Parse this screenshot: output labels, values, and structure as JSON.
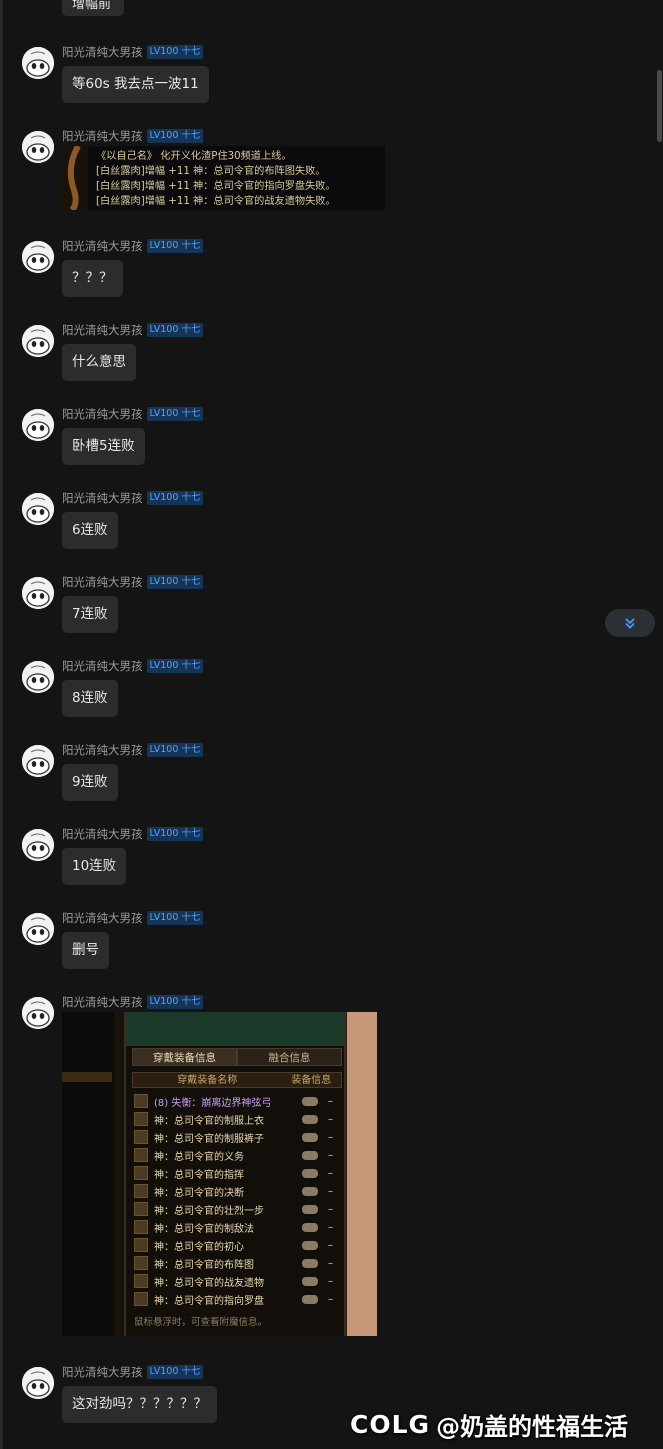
{
  "top_partial_text": "增幅前",
  "messages": [
    {
      "user": "阳光清纯大男孩",
      "level": "LV100 十七",
      "text": "等60s  我去点一波11"
    },
    {
      "user": "阳光清纯大男孩",
      "level": "LV100 十七",
      "image": "game-log"
    },
    {
      "user": "阳光清纯大男孩",
      "level": "LV100 十七",
      "text": "？？？"
    },
    {
      "user": "阳光清纯大男孩",
      "level": "LV100 十七",
      "text": "什么意思"
    },
    {
      "user": "阳光清纯大男孩",
      "level": "LV100 十七",
      "text": "卧槽5连败"
    },
    {
      "user": "阳光清纯大男孩",
      "level": "LV100 十七",
      "text": "6连败"
    },
    {
      "user": "阳光清纯大男孩",
      "level": "LV100 十七",
      "text": "7连败"
    },
    {
      "user": "阳光清纯大男孩",
      "level": "LV100 十七",
      "text": "8连败"
    },
    {
      "user": "阳光清纯大男孩",
      "level": "LV100 十七",
      "text": "9连败"
    },
    {
      "user": "阳光清纯大男孩",
      "level": "LV100 十七",
      "text": "10连败"
    },
    {
      "user": "阳光清纯大男孩",
      "level": "LV100 十七",
      "text": "删号"
    },
    {
      "user": "阳光清纯大男孩",
      "level": "LV100 十七",
      "image": "equipment-panel"
    },
    {
      "user": "阳光清纯大男孩",
      "level": "LV100 十七",
      "text": "这对劲吗？？？？？？"
    }
  ],
  "game_log": {
    "lines": [
      "《以自己名》 化开义化渣P住30频道上线。",
      "[白丝露肉]增幅 +11 神：总司令官的布阵图失败。",
      "[白丝露肉]增幅 +11 神：总司令官的指向罗盘失败。",
      "[白丝露肉]增幅 +11 神：总司令官的战友遗物失败。"
    ]
  },
  "equipment_panel": {
    "tabs": [
      "穿戴装备信息",
      "融合信息"
    ],
    "columns": [
      "穿戴装备名称",
      "装备信息"
    ],
    "items": [
      {
        "name": "(8) 失衡：崩离边界神弦弓",
        "purple": true,
        "info": "–"
      },
      {
        "name": "神：总司令官的制服上衣",
        "info": "–"
      },
      {
        "name": "神：总司令官的制服裤子",
        "info": "–"
      },
      {
        "name": "神：总司令官的义务",
        "info": "–"
      },
      {
        "name": "神：总司令官的指挥",
        "info": "–"
      },
      {
        "name": "神：总司令官的决断",
        "info": "–"
      },
      {
        "name": "神：总司令官的壮烈一步",
        "info": "–"
      },
      {
        "name": "神：总司令官的制敌法",
        "info": "–"
      },
      {
        "name": "神：总司令官的初心",
        "info": "–"
      },
      {
        "name": "神：总司令官的布阵图",
        "info": "–"
      },
      {
        "name": "神：总司令官的战友遗物",
        "info": "–"
      },
      {
        "name": "神：总司令官的指向罗盘",
        "info": "–"
      }
    ],
    "hint": "鼠标悬浮时，可查看附魔信息。"
  },
  "watermark": {
    "logo": "COLG",
    "text": "@奶盖的性福生活"
  },
  "colors": {
    "background": "#141414",
    "bubble": "#2c2c2c",
    "level_badge": "#4fa3ff",
    "username": "#9a9a9a"
  }
}
